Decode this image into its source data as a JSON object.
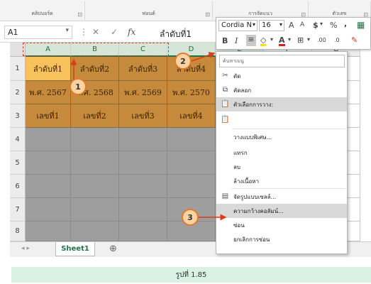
{
  "ribbon": {
    "groups": [
      {
        "label": "คลิปบอร์ด",
        "launcher": "⊡"
      },
      {
        "label": "ฟอนต์",
        "launcher": "⊡"
      },
      {
        "label": "การจัดแนว",
        "launcher": "⊡"
      },
      {
        "label": "ตัวเลข",
        "launcher": "⊡"
      }
    ]
  },
  "formula_bar": {
    "name_box": "A1",
    "cancel_glyph": "✕",
    "enter_glyph": "✓",
    "fx_glyph": "fx",
    "content": "ลำดับที่1"
  },
  "columns": [
    "A",
    "B",
    "C",
    "D",
    "E",
    "F",
    "G"
  ],
  "rows": [
    "1",
    "2",
    "3",
    "4",
    "5",
    "6",
    "7",
    "8"
  ],
  "cells": [
    [
      "ลำดับที่1",
      "ลำดับที่2",
      "ลำดับที่3",
      "ลำดับที่4"
    ],
    [
      "พ.ศ. 2567",
      "พ.ศ. 2568",
      "พ.ศ. 2569",
      "พ.ศ. 2570"
    ],
    [
      "เลขที่1",
      "เลขที่2",
      "เลขที่3",
      "เลขที่4"
    ]
  ],
  "sheet": {
    "tab": "Sheet1",
    "add_glyph": "⊕",
    "nav_glyphs": "◂  ▸"
  },
  "mini_toolbar": {
    "font": "Cordia N",
    "size": "16",
    "grow_glyph": "A",
    "shrink_glyph": "A",
    "currency_glyph": "$",
    "percent_glyph": "%",
    "comma_glyph": ",",
    "bold_glyph": "B",
    "italic_glyph": "I",
    "align_glyph": "≡",
    "fill_glyph": "◇",
    "fontcolor_glyph": "A",
    "border_glyph": "⊞",
    "inc_dec_glyph": ".00",
    "dec_dec_glyph": ".0",
    "brush_glyph": "✎"
  },
  "context_menu": {
    "search_placeholder": "ค้นหาเมนู",
    "items": [
      {
        "label": "ตัด",
        "icon": "scissors-icon",
        "glyph": "✂",
        "highlight": false
      },
      {
        "label": "คัดลอก",
        "icon": "copy-icon",
        "glyph": "⧉",
        "highlight": false
      },
      {
        "label": "ตัวเลือกการวาง:",
        "icon": "paste-options-icon",
        "glyph": "📋",
        "highlight": true
      },
      {
        "label": "",
        "icon": "paste-icon",
        "glyph": "📋",
        "highlight": false
      },
      {
        "label": "วางแบบพิเศษ...",
        "icon": "",
        "glyph": "",
        "highlight": false
      },
      {
        "label": "แทรก",
        "icon": "",
        "glyph": "",
        "highlight": false
      },
      {
        "label": "ลบ",
        "icon": "",
        "glyph": "",
        "highlight": false
      },
      {
        "label": "ล้างเนื้อหา",
        "icon": "",
        "glyph": "",
        "highlight": false
      },
      {
        "label": "จัดรูปแบบเซลล์...",
        "icon": "format-cells-icon",
        "glyph": "▤",
        "highlight": false
      },
      {
        "label": "ความกว้างคอลัมน์...",
        "icon": "",
        "glyph": "",
        "highlight": true
      },
      {
        "label": "ซ่อน",
        "icon": "",
        "glyph": "",
        "highlight": false
      },
      {
        "label": "ยกเลิกการซ่อน",
        "icon": "",
        "glyph": "",
        "highlight": false
      }
    ]
  },
  "annotations": [
    {
      "number": "1"
    },
    {
      "number": "2"
    },
    {
      "number": "3"
    }
  ],
  "caption": "รูปที่ 1.85",
  "colors": {
    "header_cell": "#f7c15b",
    "data_cell": "#c68a3c",
    "annotation_border": "#e37b26",
    "annotation_fill": "#f9d3a3",
    "caption_bg": "#d9f2e4",
    "excel_green": "#217346"
  }
}
